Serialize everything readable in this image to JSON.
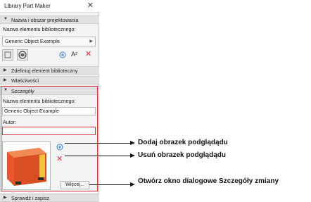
{
  "window": {
    "title": "Library Part Maker",
    "close_glyph": "✕"
  },
  "sections": {
    "s1": "Nazwa i obszar projektowania",
    "s2": "Zdefiniuj element biblioteczny",
    "s3": "Właściwości",
    "s4": "Szczegóły",
    "s5": "Sprawdź i zapisz"
  },
  "top": {
    "name_label": "Nazwa elementu bibliotecznego:",
    "name_combo_value": "Generic Object Example"
  },
  "details": {
    "name_label": "Nazwa elementu bibliotecznego:",
    "name_value": "Generic Object Example",
    "author_label": "Autor:",
    "author_value": "",
    "more_button": "Więcej..."
  },
  "icons": {
    "toolbar": [
      "select-area-icon",
      "zoom-icon",
      "add-icon",
      "text-size-icon",
      "delete-icon"
    ],
    "preview": [
      "add-icon",
      "delete-icon"
    ],
    "accent_blue": "#2f7fd6",
    "accent_red": "#e0303a"
  },
  "callouts": {
    "add": "Dodaj obrazek podglądądu",
    "remove": "Usuń obrazek podglądądu",
    "open": "Otwórz okno dialogowe Szczegóły zmiany"
  }
}
